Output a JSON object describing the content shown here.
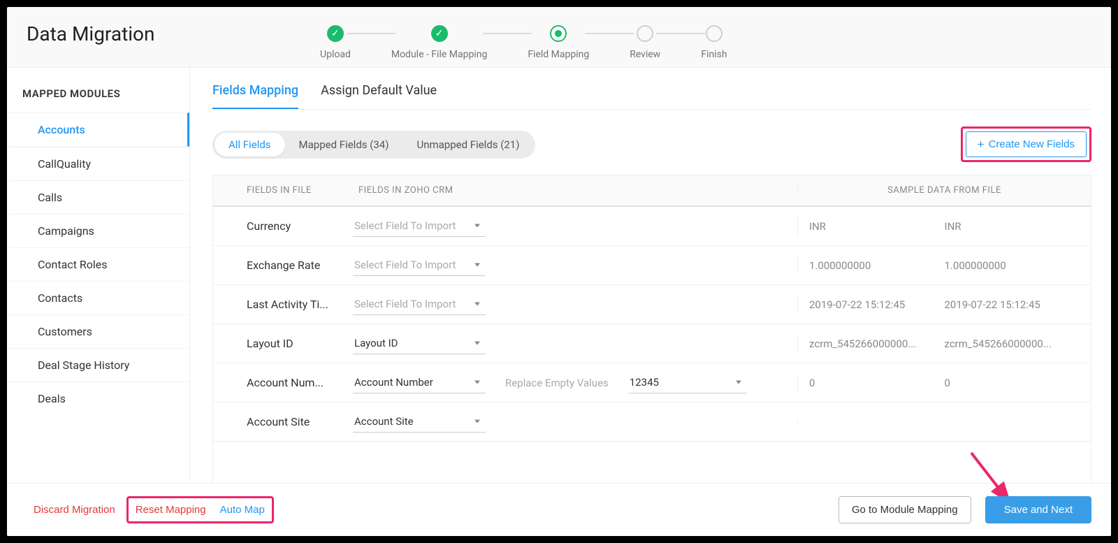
{
  "page_title": "Data Migration",
  "steps": [
    {
      "label": "Upload",
      "state": "done"
    },
    {
      "label": "Module - File Mapping",
      "state": "done"
    },
    {
      "label": "Field Mapping",
      "state": "active"
    },
    {
      "label": "Review",
      "state": "future"
    },
    {
      "label": "Finish",
      "state": "future"
    }
  ],
  "sidebar": {
    "title": "MAPPED MODULES",
    "items": [
      {
        "label": "Accounts",
        "active": true
      },
      {
        "label": "CallQuality"
      },
      {
        "label": "Calls"
      },
      {
        "label": "Campaigns"
      },
      {
        "label": "Contact Roles"
      },
      {
        "label": "Contacts"
      },
      {
        "label": "Customers"
      },
      {
        "label": "Deal Stage History"
      },
      {
        "label": "Deals"
      }
    ]
  },
  "tabs": [
    {
      "label": "Fields Mapping",
      "active": true
    },
    {
      "label": "Assign Default Value"
    }
  ],
  "filters": [
    {
      "label": "All Fields",
      "active": true
    },
    {
      "label": "Mapped Fields (34)"
    },
    {
      "label": "Unmapped Fields (21)"
    }
  ],
  "create_btn": "Create New Fields",
  "table": {
    "headers": {
      "file": "FIELDS IN FILE",
      "crm": "FIELDS IN ZOHO CRM",
      "sample": "SAMPLE DATA FROM FILE"
    },
    "placeholder_select": "Select Field To Import",
    "replace_placeholder": "Replace Empty Values",
    "rows": [
      {
        "file": "Currency",
        "crm": "",
        "sample1": "INR",
        "sample2": "INR"
      },
      {
        "file": "Exchange Rate",
        "crm": "",
        "sample1": "1.000000000",
        "sample2": "1.000000000"
      },
      {
        "file": "Last Activity Ti...",
        "crm": "",
        "sample1": "2019-07-22 15:12:45",
        "sample2": "2019-07-22 15:12:45"
      },
      {
        "file": "Layout ID",
        "crm": "Layout ID",
        "sample1": "zcrm_545266000000...",
        "sample2": "zcrm_545266000000..."
      },
      {
        "file": "Account Num...",
        "crm": "Account Number",
        "replace_value": "12345",
        "show_replace": true,
        "sample1": "0",
        "sample2": "0"
      },
      {
        "file": "Account Site",
        "crm": "Account Site",
        "sample1": "",
        "sample2": ""
      }
    ]
  },
  "footer": {
    "discard": "Discard Migration",
    "reset": "Reset Mapping",
    "auto_map": "Auto Map",
    "go_module": "Go to Module Mapping",
    "save_next": "Save and Next"
  }
}
